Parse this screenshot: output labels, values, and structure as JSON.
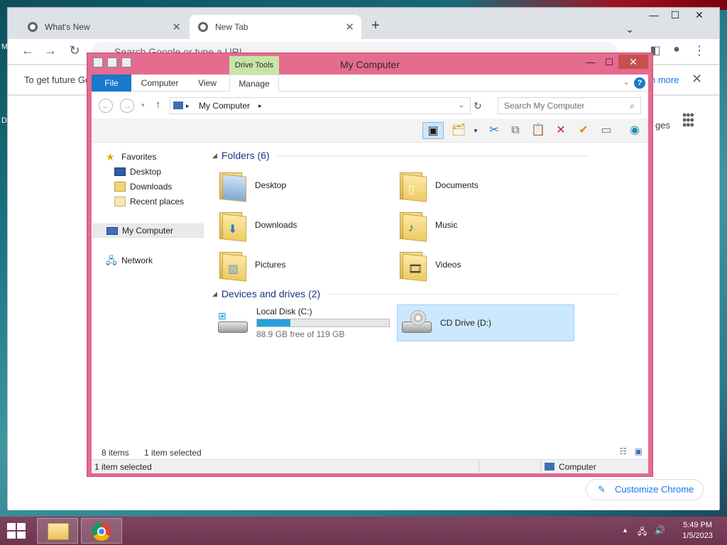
{
  "chrome": {
    "tabs": [
      {
        "title": "What's New",
        "active": false
      },
      {
        "title": "New Tab",
        "active": true
      }
    ],
    "omnibox_placeholder": "Search Google or type a URL",
    "infobar_text": "To get future Go",
    "infobar_link": "n more",
    "images_text": "ges",
    "customize_label": "Customize Chrome"
  },
  "explorer": {
    "title": "My Computer",
    "contextual_tab": "Drive Tools",
    "ribbon_tabs": [
      "File",
      "Computer",
      "View",
      "Manage"
    ],
    "address": "My Computer",
    "search_placeholder": "Search My Computer",
    "nav": {
      "favorites": "Favorites",
      "desktop": "Desktop",
      "downloads": "Downloads",
      "recent": "Recent places",
      "computer": "My Computer",
      "network": "Network"
    },
    "folders_header": "Folders (6)",
    "folders": [
      "Desktop",
      "Documents",
      "Downloads",
      "Music",
      "Pictures",
      "Videos"
    ],
    "drives_header": "Devices and drives (2)",
    "drives": {
      "c_name": "Local Disk (C:)",
      "c_free": "88.9 GB free of 119 GB",
      "c_used_fraction": 0.253,
      "d_name": "CD Drive (D:)"
    },
    "status": {
      "items": "8 items",
      "selected": "1 item selected",
      "bottom_left": "1 item selected",
      "bottom_right": "Computer"
    }
  },
  "taskbar": {
    "time": "5:49 PM",
    "date": "1/5/2023"
  },
  "colors": {
    "explorer_frame": "#e56b8f",
    "file_tab": "#1979ca",
    "drive_tools": "#c7e5a8",
    "selection": "#cce8ff"
  }
}
